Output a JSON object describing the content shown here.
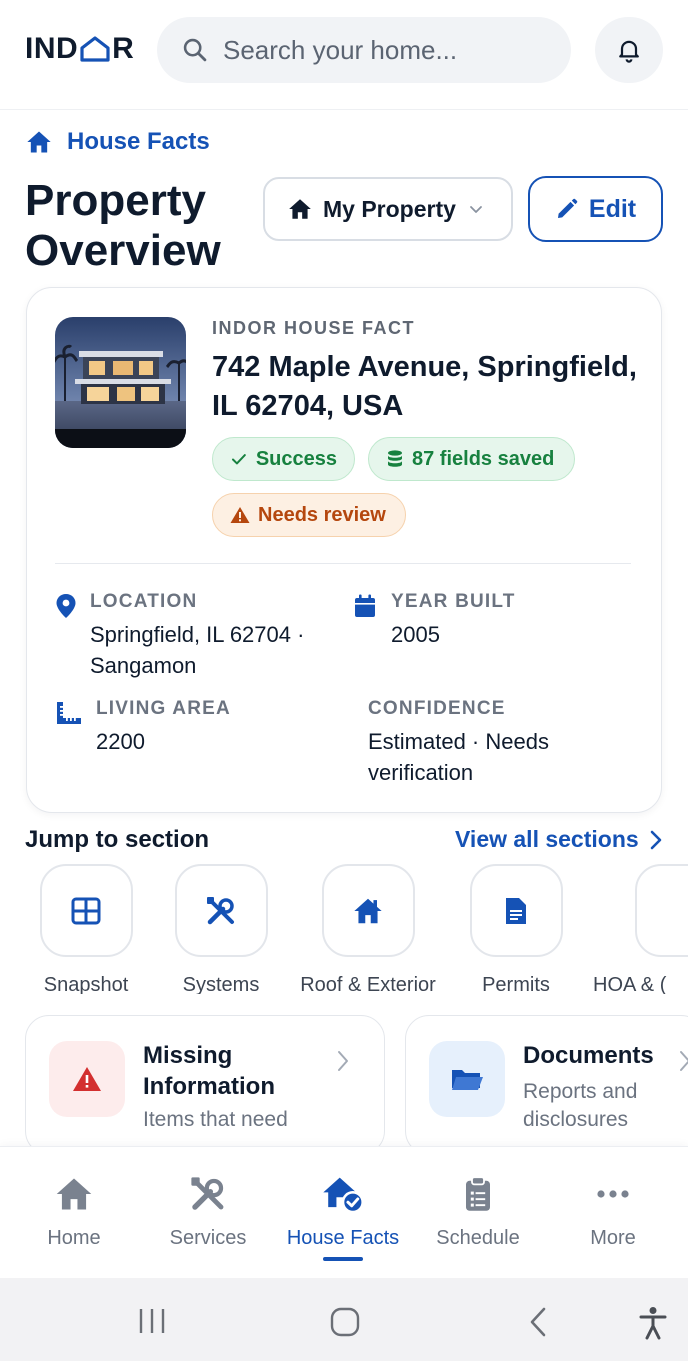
{
  "app": {
    "logo_text_left": "IND",
    "logo_text_right": "R"
  },
  "search": {
    "placeholder": "Search your home..."
  },
  "breadcrumb": {
    "label": "House Facts"
  },
  "header": {
    "title": "Property Overview",
    "property_select": "My Property",
    "edit_label": "Edit"
  },
  "property": {
    "kicker": "INDOR HOUSE FACT",
    "address": "742 Maple Avenue, Springfield, IL 62704, USA",
    "badges": {
      "success": "Success",
      "saved": "87 fields saved",
      "review": "Needs review"
    },
    "facts": {
      "location_label": "LOCATION",
      "location_value": "Springfield, IL 62704 · Sangamon",
      "year_label": "YEAR BUILT",
      "year_value": "2005",
      "area_label": "LIVING AREA",
      "area_value": "2200",
      "confidence_label": "CONFIDENCE",
      "confidence_value": "Estimated · Needs verification"
    }
  },
  "jump": {
    "title": "Jump to section",
    "view_all": "View all sections",
    "sections": [
      {
        "label": "Snapshot",
        "icon": "grid-icon"
      },
      {
        "label": "Systems",
        "icon": "tools-icon"
      },
      {
        "label": "Roof & Exterior",
        "icon": "house-icon"
      },
      {
        "label": "Permits",
        "icon": "document-icon"
      },
      {
        "label": "HOA & (",
        "icon": "hoa-icon"
      }
    ]
  },
  "cards": {
    "missing_title": "Missing Information",
    "missing_sub": "Items that need",
    "docs_title": "Documents",
    "docs_sub": "Reports and disclosures"
  },
  "nav": {
    "items": [
      {
        "label": "Home",
        "icon": "home-icon"
      },
      {
        "label": "Services",
        "icon": "tools-icon"
      },
      {
        "label": "House Facts",
        "icon": "house-check-icon",
        "active": true
      },
      {
        "label": "Schedule",
        "icon": "clipboard-icon"
      },
      {
        "label": "More",
        "icon": "more-icon"
      }
    ]
  },
  "colors": {
    "brand": "#1552b5",
    "text": "#0f1b2d",
    "success": "#17813f",
    "warning": "#b5470e",
    "danger": "#d32f2f"
  }
}
